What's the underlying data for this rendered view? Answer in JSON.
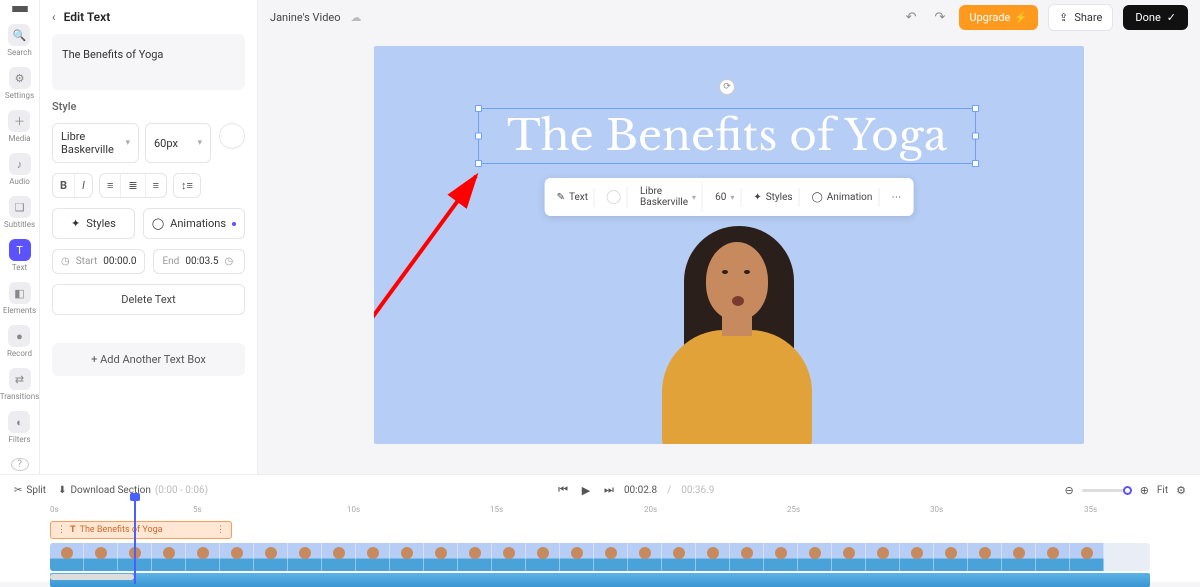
{
  "project": {
    "title": "Janine's Video"
  },
  "topbar": {
    "upgrade": "Upgrade",
    "share": "Share",
    "done": "Done"
  },
  "rail": {
    "items": [
      {
        "label": "Search",
        "icon": "🔍"
      },
      {
        "label": "Settings",
        "icon": "⚙"
      },
      {
        "label": "Media",
        "icon": "＋"
      },
      {
        "label": "Audio",
        "icon": "♪"
      },
      {
        "label": "Subtitles",
        "icon": "❏"
      },
      {
        "label": "Text",
        "icon": "T"
      },
      {
        "label": "Elements",
        "icon": "◧"
      },
      {
        "label": "Record",
        "icon": "●"
      },
      {
        "label": "Transitions",
        "icon": "⇄"
      },
      {
        "label": "Filters",
        "icon": "◐"
      }
    ]
  },
  "panel": {
    "title": "Edit Text",
    "textValue": "The Benefits of Yoga",
    "styleLabel": "Style",
    "font": "Libre Baskerville",
    "size": "60px",
    "stylesBtn": "Styles",
    "animBtn": "Animations",
    "startLabel": "Start",
    "startVal": "00:00.0",
    "endLabel": "End",
    "endVal": "00:03.5",
    "delete": "Delete Text",
    "add": "+  Add Another Text Box"
  },
  "canvas": {
    "titleText": "The Benefits of Yoga",
    "float": {
      "text": "Text",
      "font": "Libre Baskerville",
      "size": "60",
      "styles": "Styles",
      "anim": "Animation"
    }
  },
  "controls": {
    "split": "Split",
    "download": "Download Section",
    "downloadRange": "(0:00 - 0:06)",
    "cur": "00:02.8",
    "total": "00:36.9",
    "fit": "Fit"
  },
  "ruler": [
    "0s",
    "5s",
    "10s",
    "15s",
    "20s",
    "25s",
    "30s",
    "35s"
  ],
  "textClip": "The Benefits of Yoga"
}
